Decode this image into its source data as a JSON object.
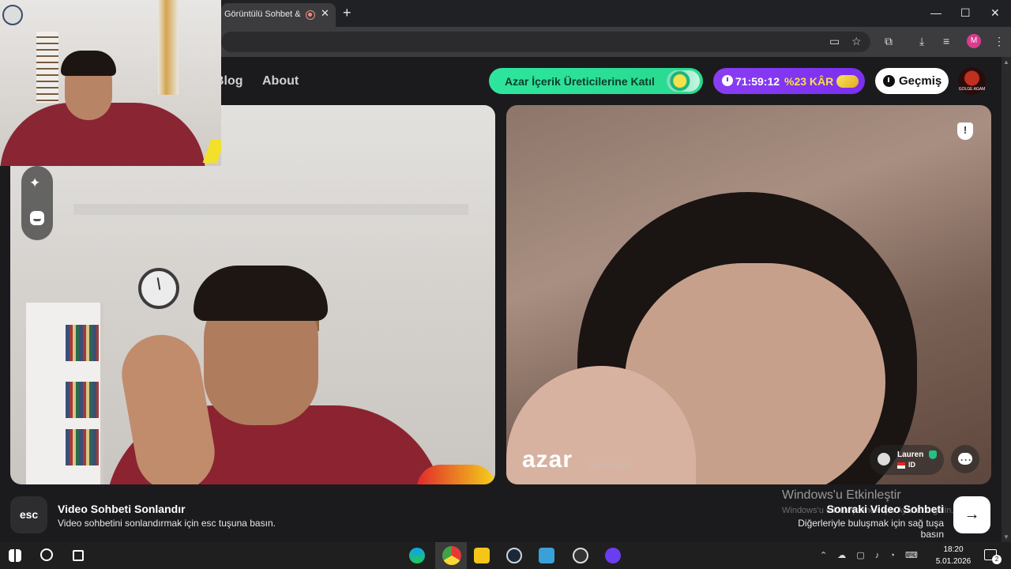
{
  "browser": {
    "tab_title": "Görüntülü Sohbet & Y",
    "tab_close": "✕",
    "new_tab": "+",
    "profile_initial": "M",
    "window_min": "—",
    "window_max": "☐",
    "window_close": "✕"
  },
  "header": {
    "nav_blog": "Blog",
    "nav_about": "About",
    "creator_cta": "Azar İçerik Üreticilerine Katıl",
    "promo_timer": "71:59:12",
    "promo_profit": "%23 KÂR",
    "history": "Geçmiş",
    "avatar_text": "GOLGE AGAM"
  },
  "remote": {
    "logo": "azar",
    "session_code": "90cY+RJpsC",
    "partner_name": "Lauren",
    "partner_country": "ID",
    "report_icon": "!"
  },
  "footer": {
    "esc_key": "esc",
    "end_title": "Video Sohbeti Sonlandır",
    "end_desc": "Video sohbetini sonlandırmak için esc tuşuna basın.",
    "next_title": "Sonraki Video Sohbeti",
    "next_desc": "Diğerleriyle buluşmak için sağ tuşa basın",
    "next_arrow": "→"
  },
  "windows_watermark": {
    "title": "Windows'u Etkinleştir",
    "subtitle": "Windows'u etkinleştirmek için Ayarlar'a gidin."
  },
  "taskbar": {
    "time": "18:20",
    "date": "5.01.2026",
    "notifications": "2",
    "tray_icons": "⌃ ☁ ▢ ♪ ◔ ⌨"
  },
  "colors": {
    "creator_green": "#2ee59d",
    "promo_purple": "#7b2ff0",
    "verified_green": "#23c183"
  }
}
